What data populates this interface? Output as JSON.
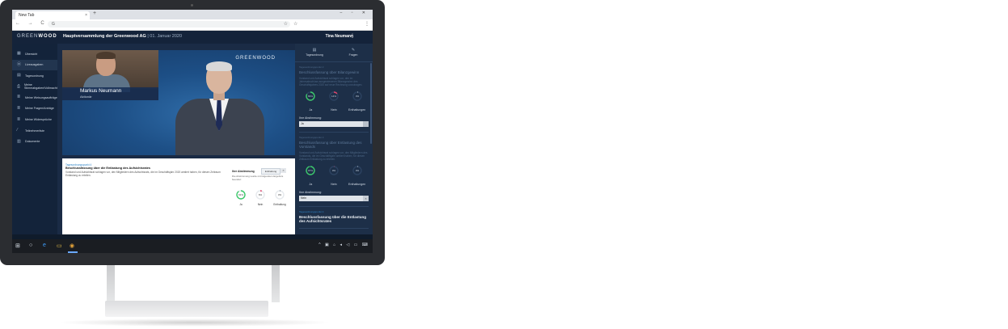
{
  "browser": {
    "tab_title": "New Tab",
    "tab_close": "×",
    "new_tab": "+",
    "window_controls": "– ▫ ✕",
    "nav_icons": "← → C ⌂",
    "url": "G",
    "star": "☆",
    "bookmark_icon": "☆",
    "menu": "⋮"
  },
  "header": {
    "logo_light": "GREEN",
    "logo_bold": "WOOD",
    "event_title": "Hauptversammlung der Greenwood AG",
    "event_date": "| 01. Januar 2020",
    "user_name": "Tina Neumann",
    "menu": "⋮"
  },
  "sidebar": {
    "items": [
      {
        "icon": "▦",
        "label": "Übersicht"
      },
      {
        "icon": "⦿",
        "label": "Liveausgaben"
      },
      {
        "icon": "▤",
        "label": "Tagesordnung"
      },
      {
        "icon": "⎙",
        "label": "Meine Stimmabgaben/Vollmachten"
      },
      {
        "icon": "≣",
        "label": "Meine Weisungsaufträge"
      },
      {
        "icon": "≣",
        "label": "Meine Fragen/Anträge"
      },
      {
        "icon": "≣",
        "label": "Meine Widersprüche"
      },
      {
        "icon": "⁄",
        "label": "Teilnehmerliste"
      },
      {
        "icon": "▥",
        "label": "Dokumente"
      }
    ]
  },
  "video": {
    "watermark": "GREENWOOD",
    "pip_name": "Markus Neumann",
    "pip_role": "Aktionär"
  },
  "doc": {
    "tag": "Tagesordnungspunkt 4",
    "title": "Beschlussfassung über die Entlastung des Aufsichtsrates",
    "description": "Vorstand und Aufsichtsrat schlagen vor, den Mitgliedern des Aufsichtsrats, die im Geschäftsjahr 2020 amtiert haben, für diesen Zeitraum Entlastung zu erteilen.",
    "vote_label": "Ihre Abstimmung",
    "vote_value": "Enthaltung",
    "vote_clear": "×",
    "vote_note": "Die Abstimmung wurde mit folgendem Ergebnis beendet:",
    "results": [
      {
        "label": "Ja",
        "value": "91%",
        "pct": 91,
        "color": "#3cc96b"
      },
      {
        "label": "Nein",
        "value": "6%",
        "pct": 6,
        "color": "#e0446a"
      },
      {
        "label": "Enthaltung",
        "value": "3%",
        "pct": 3,
        "color": "#8a97a6"
      }
    ]
  },
  "rpanel": {
    "tabs": [
      {
        "icon": "▤",
        "label": "Tagesordnung"
      },
      {
        "icon": "✎",
        "label": "Fragen"
      }
    ],
    "cards": [
      {
        "tag": "Tagesordnungspunkt 2",
        "title": "Beschlussfassung über Bilanzgewinn",
        "description": "Vorstand und Aufsichtsrat schlagen vor, den im Jahresabschluss ausgewiesenen Bilanzgewinn des Geschäftsjahres 2020 auf neue Rechnung vorzutragen.",
        "results": [
          {
            "label": "Ja",
            "value": "83%",
            "pct": 83,
            "color": "#3cc96b"
          },
          {
            "label": "Nein",
            "value": "14%",
            "pct": 14,
            "color": "#e0446a"
          },
          {
            "label": "Enthaltungen",
            "value": "3%",
            "pct": 3,
            "color": "#8a97a6"
          }
        ],
        "my_vote_label": "Ihre Abstimmung:",
        "my_vote": "Ja"
      },
      {
        "tag": "Tagesordnungspunkt 3",
        "title": "Beschlussfassung über Entlastung des Vorstands",
        "description": "Vorstand und Aufsichtsrat schlagen vor, den Mitgliedern des Vorstands, die im Geschäftsjahr amtiert haben, für diesen Zeitraum Entlastung zu erteilen.",
        "results": [
          {
            "label": "Ja",
            "value": "97%",
            "pct": 97,
            "color": "#3cc96b"
          },
          {
            "label": "Nein",
            "value": "0%",
            "pct": 0,
            "color": "#e0446a"
          },
          {
            "label": "Enthaltungen",
            "value": "3%",
            "pct": 3,
            "color": "#8a97a6"
          }
        ],
        "my_vote_label": "Ihre Abstimmung:",
        "my_vote": "Nein"
      },
      {
        "tag": "Tagesordnungspunkt 4",
        "title": "Beschlussfassung über die Entlastung des Aufsichtsrates"
      }
    ]
  },
  "taskbar": {
    "start": "⊞",
    "search": "○",
    "edge": "e",
    "explorer": "▭",
    "chrome": "◉",
    "tray": "^ ▣ ⌂ ◂ ◁ ▭ ⌨"
  }
}
